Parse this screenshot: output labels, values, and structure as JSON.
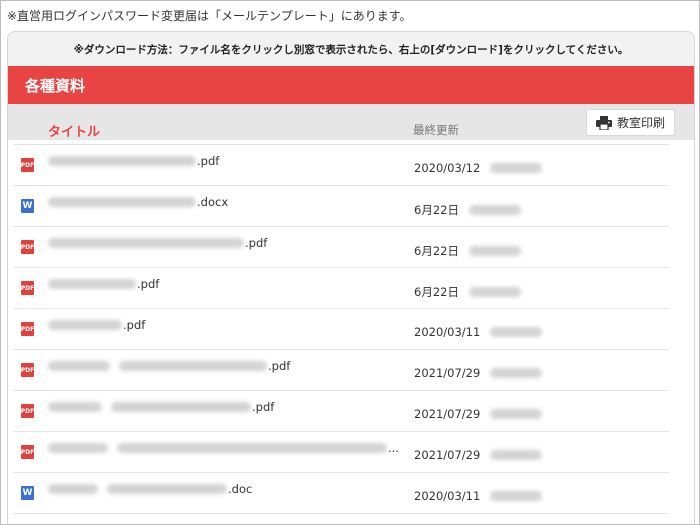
{
  "top_note": "※直営用ログインパスワード変更届は「メールテンプレート」にあります。",
  "download_info": "※ダウンロード方法：ファイル名をクリックし別窓で表示されたら、右上の[ダウンロード]をクリックしてください。",
  "section_title": "各種資料",
  "print_button_label": "教室印刷",
  "table": {
    "col_title": "タイトル",
    "col_updated": "最終更新",
    "rows": [
      {
        "icon": "pdf",
        "icon_label": "PDF",
        "name_suffix": ".pdf",
        "date": "2020/03/12"
      },
      {
        "icon": "word",
        "icon_label": "W",
        "name_suffix": ".docx",
        "date": "6月22日"
      },
      {
        "icon": "pdf",
        "icon_label": "PDF",
        "name_suffix": ".pdf",
        "date": "6月22日"
      },
      {
        "icon": "pdf",
        "icon_label": "PDF",
        "name_suffix": ".pdf",
        "date": "6月22日"
      },
      {
        "icon": "pdf",
        "icon_label": "PDF",
        "name_suffix": ".pdf",
        "date": "2020/03/11"
      },
      {
        "icon": "pdf",
        "icon_label": "PDF",
        "name_suffix": ".pdf",
        "date": "2021/07/29"
      },
      {
        "icon": "pdf",
        "icon_label": "PDF",
        "name_suffix": ".pdf",
        "date": "2021/07/29"
      },
      {
        "icon": "pdf",
        "icon_label": "PDF",
        "name_suffix": "...",
        "date": "2021/07/29"
      },
      {
        "icon": "word",
        "icon_label": "W",
        "name_suffix": ".doc",
        "date": "2020/03/11"
      }
    ]
  },
  "colors": {
    "accent": "#e94444",
    "pdf_icon": "#e0413a",
    "word_icon": "#3b6fd4"
  },
  "icons": {
    "print": "printer-icon",
    "pdf": "pdf-file-icon",
    "word": "word-file-icon"
  }
}
